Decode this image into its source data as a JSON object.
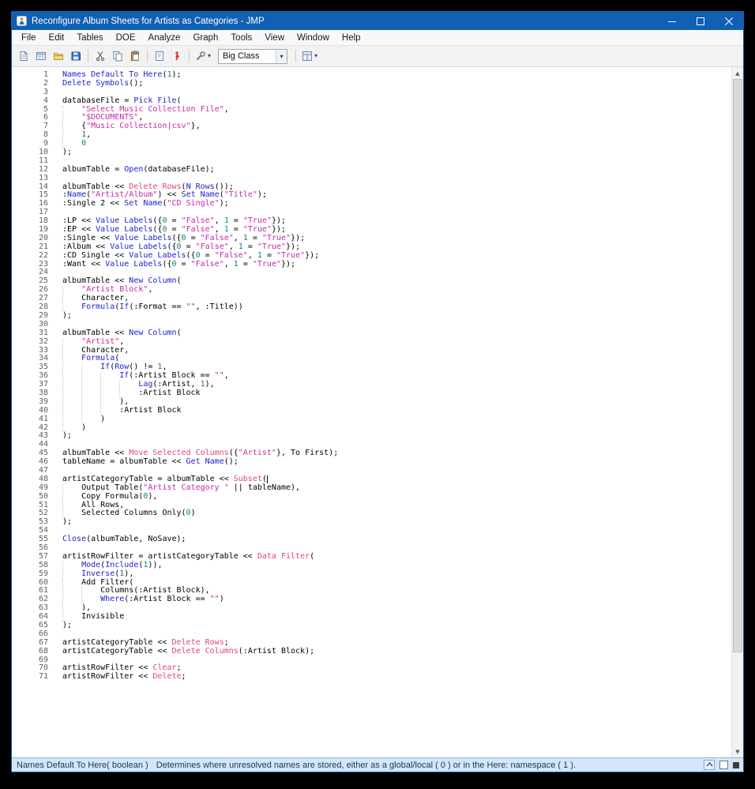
{
  "window": {
    "title": "Reconfigure Album Sheets for Artists as Categories - JMP"
  },
  "menubar": {
    "items": [
      "File",
      "Edit",
      "Tables",
      "DOE",
      "Analyze",
      "Graph",
      "Tools",
      "View",
      "Window",
      "Help"
    ]
  },
  "toolbar": {
    "groups_left": [
      [
        "new-script",
        "new-data-table",
        "open-file",
        "save"
      ],
      [
        "cut",
        "copy",
        "paste"
      ],
      [
        "journal",
        "run-script"
      ],
      [
        "tools"
      ]
    ],
    "groups_right": [
      [
        "window-layout"
      ]
    ],
    "dropdown_buttons": [
      "tools",
      "window-layout"
    ],
    "combo_value": "Big Class"
  },
  "colors": {
    "titlebar": "#1160b4",
    "keyword": "#2121cc",
    "string": "#c428a8",
    "number": "#0d7f7f",
    "message": "#df4578",
    "line_number": "#5f5f5f",
    "status_bg": "#d4e6f8",
    "status_text": "#17375e"
  },
  "statusbar": {
    "signature": "Names Default To Here( boolean )",
    "description": "Determines where unresolved names are stored, either as a global/local ( 0 ) or in the Here: namespace ( 1 )."
  },
  "editor": {
    "caret_line": 48,
    "lines": [
      {
        "n": 1,
        "t": [
          [
            "k",
            "Names Default To Here"
          ],
          [
            "p",
            "("
          ],
          [
            "n",
            "1"
          ],
          [
            "p",
            ");"
          ]
        ]
      },
      {
        "n": 2,
        "t": [
          [
            "k",
            "Delete Symbols"
          ],
          [
            "p",
            "();"
          ]
        ]
      },
      {
        "n": 3,
        "t": []
      },
      {
        "n": 4,
        "t": [
          [
            "p",
            "databaseFile = "
          ],
          [
            "k",
            "Pick File"
          ],
          [
            "p",
            "("
          ]
        ]
      },
      {
        "n": 5,
        "ind": 1,
        "t": [
          [
            "s",
            "\"Select Music Collection File\""
          ],
          [
            "p",
            ","
          ]
        ]
      },
      {
        "n": 6,
        "ind": 1,
        "t": [
          [
            "s",
            "\"$DOCUMENTS\""
          ],
          [
            "p",
            ","
          ]
        ]
      },
      {
        "n": 7,
        "ind": 1,
        "t": [
          [
            "p",
            "{"
          ],
          [
            "s",
            "\"Music Collection|csv\""
          ],
          [
            "p",
            "},"
          ]
        ]
      },
      {
        "n": 8,
        "ind": 1,
        "t": [
          [
            "n",
            "1"
          ],
          [
            "p",
            ","
          ]
        ]
      },
      {
        "n": 9,
        "ind": 1,
        "t": [
          [
            "n",
            "0"
          ]
        ]
      },
      {
        "n": 10,
        "t": [
          [
            "p",
            ");"
          ]
        ]
      },
      {
        "n": 11,
        "t": []
      },
      {
        "n": 12,
        "t": [
          [
            "p",
            "albumTable = "
          ],
          [
            "k",
            "Open"
          ],
          [
            "p",
            "(databaseFile);"
          ]
        ]
      },
      {
        "n": 13,
        "t": []
      },
      {
        "n": 14,
        "t": [
          [
            "p",
            "albumTable << "
          ],
          [
            "m",
            "Delete Rows"
          ],
          [
            "p",
            "("
          ],
          [
            "k",
            "N Rows"
          ],
          [
            "p",
            "());"
          ]
        ]
      },
      {
        "n": 15,
        "t": [
          [
            "p",
            ":"
          ],
          [
            "k",
            "Name"
          ],
          [
            "p",
            "("
          ],
          [
            "s",
            "\"Artist/Album\""
          ],
          [
            "p",
            ") << "
          ],
          [
            "k",
            "Set Name"
          ],
          [
            "p",
            "("
          ],
          [
            "s",
            "\"Title\""
          ],
          [
            "p",
            ");"
          ]
        ]
      },
      {
        "n": 16,
        "t": [
          [
            "p",
            ":Single 2 << "
          ],
          [
            "k",
            "Set Name"
          ],
          [
            "p",
            "("
          ],
          [
            "s",
            "\"CD Single\""
          ],
          [
            "p",
            ");"
          ]
        ]
      },
      {
        "n": 17,
        "t": []
      },
      {
        "n": 18,
        "t": [
          [
            "p",
            ":LP << "
          ],
          [
            "k",
            "Value Labels"
          ],
          [
            "p",
            "({"
          ],
          [
            "n",
            "0"
          ],
          [
            "p",
            " = "
          ],
          [
            "s",
            "\"False\""
          ],
          [
            "p",
            ", "
          ],
          [
            "n",
            "1"
          ],
          [
            "p",
            " = "
          ],
          [
            "s",
            "\"True\""
          ],
          [
            "p",
            "});"
          ]
        ]
      },
      {
        "n": 19,
        "t": [
          [
            "p",
            ":EP << "
          ],
          [
            "k",
            "Value Labels"
          ],
          [
            "p",
            "({"
          ],
          [
            "n",
            "0"
          ],
          [
            "p",
            " = "
          ],
          [
            "s",
            "\"False\""
          ],
          [
            "p",
            ", "
          ],
          [
            "n",
            "1"
          ],
          [
            "p",
            " = "
          ],
          [
            "s",
            "\"True\""
          ],
          [
            "p",
            "});"
          ]
        ]
      },
      {
        "n": 20,
        "t": [
          [
            "p",
            ":Single << "
          ],
          [
            "k",
            "Value Labels"
          ],
          [
            "p",
            "({"
          ],
          [
            "n",
            "0"
          ],
          [
            "p",
            " = "
          ],
          [
            "s",
            "\"False\""
          ],
          [
            "p",
            ", "
          ],
          [
            "n",
            "1"
          ],
          [
            "p",
            " = "
          ],
          [
            "s",
            "\"True\""
          ],
          [
            "p",
            "});"
          ]
        ]
      },
      {
        "n": 21,
        "t": [
          [
            "p",
            ":Album << "
          ],
          [
            "k",
            "Value Labels"
          ],
          [
            "p",
            "({"
          ],
          [
            "n",
            "0"
          ],
          [
            "p",
            " = "
          ],
          [
            "s",
            "\"False\""
          ],
          [
            "p",
            ", "
          ],
          [
            "n",
            "1"
          ],
          [
            "p",
            " = "
          ],
          [
            "s",
            "\"True\""
          ],
          [
            "p",
            "});"
          ]
        ]
      },
      {
        "n": 22,
        "t": [
          [
            "p",
            ":CD Single << "
          ],
          [
            "k",
            "Value Labels"
          ],
          [
            "p",
            "({"
          ],
          [
            "n",
            "0"
          ],
          [
            "p",
            " = "
          ],
          [
            "s",
            "\"False\""
          ],
          [
            "p",
            ", "
          ],
          [
            "n",
            "1"
          ],
          [
            "p",
            " = "
          ],
          [
            "s",
            "\"True\""
          ],
          [
            "p",
            "});"
          ]
        ]
      },
      {
        "n": 23,
        "t": [
          [
            "p",
            ":Want << "
          ],
          [
            "k",
            "Value Labels"
          ],
          [
            "p",
            "({"
          ],
          [
            "n",
            "0"
          ],
          [
            "p",
            " = "
          ],
          [
            "s",
            "\"False\""
          ],
          [
            "p",
            ", "
          ],
          [
            "n",
            "1"
          ],
          [
            "p",
            " = "
          ],
          [
            "s",
            "\"True\""
          ],
          [
            "p",
            "});"
          ]
        ]
      },
      {
        "n": 24,
        "t": []
      },
      {
        "n": 25,
        "t": [
          [
            "p",
            "albumTable << "
          ],
          [
            "k",
            "New Column"
          ],
          [
            "p",
            "("
          ]
        ]
      },
      {
        "n": 26,
        "ind": 1,
        "t": [
          [
            "s",
            "\"Artist Block\""
          ],
          [
            "p",
            ","
          ]
        ]
      },
      {
        "n": 27,
        "ind": 1,
        "t": [
          [
            "p",
            "Character,"
          ]
        ]
      },
      {
        "n": 28,
        "ind": 1,
        "t": [
          [
            "k",
            "Formula"
          ],
          [
            "p",
            "("
          ],
          [
            "k",
            "If"
          ],
          [
            "p",
            "(:Format == "
          ],
          [
            "s",
            "\"\""
          ],
          [
            "p",
            ", :Title))"
          ]
        ]
      },
      {
        "n": 29,
        "t": [
          [
            "p",
            ");"
          ]
        ]
      },
      {
        "n": 30,
        "t": []
      },
      {
        "n": 31,
        "t": [
          [
            "p",
            "albumTable << "
          ],
          [
            "k",
            "New Column"
          ],
          [
            "p",
            "("
          ]
        ]
      },
      {
        "n": 32,
        "ind": 1,
        "t": [
          [
            "s",
            "\"Artist\""
          ],
          [
            "p",
            ","
          ]
        ]
      },
      {
        "n": 33,
        "ind": 1,
        "t": [
          [
            "p",
            "Character,"
          ]
        ]
      },
      {
        "n": 34,
        "ind": 1,
        "t": [
          [
            "k",
            "Formula"
          ],
          [
            "p",
            "("
          ]
        ]
      },
      {
        "n": 35,
        "ind": 2,
        "t": [
          [
            "k",
            "If"
          ],
          [
            "p",
            "("
          ],
          [
            "k",
            "Row"
          ],
          [
            "p",
            "() != "
          ],
          [
            "n",
            "1"
          ],
          [
            "p",
            ","
          ]
        ]
      },
      {
        "n": 36,
        "ind": 3,
        "t": [
          [
            "k",
            "If"
          ],
          [
            "p",
            "(:Artist Block == "
          ],
          [
            "s",
            "\"\""
          ],
          [
            "p",
            ","
          ]
        ]
      },
      {
        "n": 37,
        "ind": 4,
        "t": [
          [
            "k",
            "Lag"
          ],
          [
            "p",
            "(:Artist, "
          ],
          [
            "n",
            "1"
          ],
          [
            "p",
            "),"
          ]
        ]
      },
      {
        "n": 38,
        "ind": 4,
        "t": [
          [
            "p",
            ":Artist Block"
          ]
        ]
      },
      {
        "n": 39,
        "ind": 3,
        "t": [
          [
            "p",
            "),"
          ]
        ]
      },
      {
        "n": 40,
        "ind": 3,
        "t": [
          [
            "p",
            ":Artist Block"
          ]
        ]
      },
      {
        "n": 41,
        "ind": 2,
        "t": [
          [
            "p",
            ")"
          ]
        ]
      },
      {
        "n": 42,
        "ind": 1,
        "t": [
          [
            "p",
            ")"
          ]
        ]
      },
      {
        "n": 43,
        "t": [
          [
            "p",
            ");"
          ]
        ]
      },
      {
        "n": 44,
        "t": []
      },
      {
        "n": 45,
        "t": [
          [
            "p",
            "albumTable << "
          ],
          [
            "m",
            "Move Selected Columns"
          ],
          [
            "p",
            "({"
          ],
          [
            "s",
            "\"Artist\""
          ],
          [
            "p",
            "}, To First);"
          ]
        ]
      },
      {
        "n": 46,
        "t": [
          [
            "p",
            "tableName = albumTable << "
          ],
          [
            "k",
            "Get Name"
          ],
          [
            "p",
            "();"
          ]
        ]
      },
      {
        "n": 47,
        "t": []
      },
      {
        "n": 48,
        "t": [
          [
            "p",
            "artistCategoryTable = albumTable << "
          ],
          [
            "m",
            "Subset"
          ],
          [
            "p",
            "("
          ],
          [
            "c",
            ""
          ]
        ]
      },
      {
        "n": 49,
        "ind": 1,
        "t": [
          [
            "p",
            "Output Table("
          ],
          [
            "s",
            "\"Artist Category \""
          ],
          [
            "p",
            " || tableName),"
          ]
        ]
      },
      {
        "n": 50,
        "ind": 1,
        "t": [
          [
            "p",
            "Copy Formula("
          ],
          [
            "n",
            "0"
          ],
          [
            "p",
            "),"
          ]
        ]
      },
      {
        "n": 51,
        "ind": 1,
        "t": [
          [
            "p",
            "All Rows,"
          ]
        ]
      },
      {
        "n": 52,
        "ind": 1,
        "t": [
          [
            "p",
            "Selected Columns Only("
          ],
          [
            "n",
            "0"
          ],
          [
            "p",
            ")"
          ]
        ]
      },
      {
        "n": 53,
        "t": [
          [
            "p",
            ");"
          ]
        ]
      },
      {
        "n": 54,
        "t": []
      },
      {
        "n": 55,
        "t": [
          [
            "k",
            "Close"
          ],
          [
            "p",
            "(albumTable, NoSave);"
          ]
        ]
      },
      {
        "n": 56,
        "t": []
      },
      {
        "n": 57,
        "t": [
          [
            "p",
            "artistRowFilter = artistCategoryTable << "
          ],
          [
            "m",
            "Data Filter"
          ],
          [
            "p",
            "("
          ]
        ]
      },
      {
        "n": 58,
        "ind": 1,
        "t": [
          [
            "k",
            "Mode"
          ],
          [
            "p",
            "("
          ],
          [
            "k",
            "Include"
          ],
          [
            "p",
            "("
          ],
          [
            "n",
            "1"
          ],
          [
            "p",
            ")),"
          ]
        ]
      },
      {
        "n": 59,
        "ind": 1,
        "t": [
          [
            "k",
            "Inverse"
          ],
          [
            "p",
            "("
          ],
          [
            "n",
            "1"
          ],
          [
            "p",
            "),"
          ]
        ]
      },
      {
        "n": 60,
        "ind": 1,
        "t": [
          [
            "p",
            "Add Filter("
          ]
        ]
      },
      {
        "n": 61,
        "ind": 2,
        "t": [
          [
            "p",
            "Columns(:Artist Block),"
          ]
        ]
      },
      {
        "n": 62,
        "ind": 2,
        "t": [
          [
            "k",
            "Where"
          ],
          [
            "p",
            "(:Artist Block == "
          ],
          [
            "s",
            "\"\""
          ],
          [
            "p",
            ")"
          ]
        ]
      },
      {
        "n": 63,
        "ind": 1,
        "t": [
          [
            "p",
            "),"
          ]
        ]
      },
      {
        "n": 64,
        "ind": 1,
        "t": [
          [
            "p",
            "Invisible"
          ]
        ]
      },
      {
        "n": 65,
        "t": [
          [
            "p",
            ");"
          ]
        ]
      },
      {
        "n": 66,
        "t": []
      },
      {
        "n": 67,
        "t": [
          [
            "p",
            "artistCategoryTable << "
          ],
          [
            "m",
            "Delete Rows"
          ],
          [
            "p",
            ";"
          ]
        ]
      },
      {
        "n": 68,
        "t": [
          [
            "p",
            "artistCategoryTable << "
          ],
          [
            "m",
            "Delete Columns"
          ],
          [
            "p",
            "(:Artist Block);"
          ]
        ]
      },
      {
        "n": 69,
        "t": []
      },
      {
        "n": 70,
        "t": [
          [
            "p",
            "artistRowFilter << "
          ],
          [
            "m",
            "Clear"
          ],
          [
            "p",
            ";"
          ]
        ]
      },
      {
        "n": 71,
        "t": [
          [
            "p",
            "artistRowFilter << "
          ],
          [
            "m",
            "Delete"
          ],
          [
            "p",
            ";"
          ]
        ]
      }
    ]
  }
}
